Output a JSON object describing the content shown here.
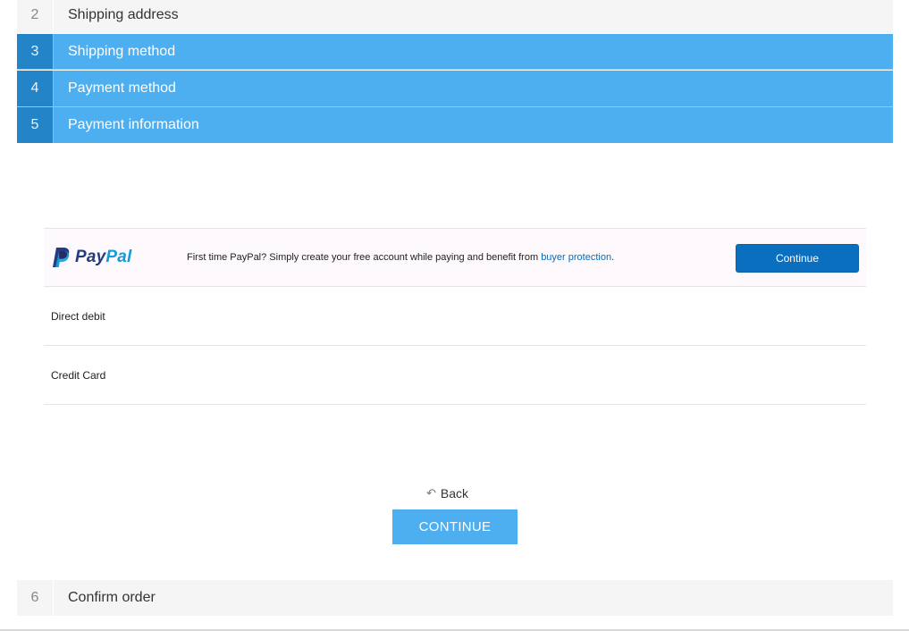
{
  "steps": [
    {
      "number": "2",
      "label": "Shipping address"
    },
    {
      "number": "3",
      "label": "Shipping method"
    },
    {
      "number": "4",
      "label": "Payment method"
    },
    {
      "number": "5",
      "label": "Payment information"
    },
    {
      "number": "6",
      "label": "Confirm order"
    }
  ],
  "payment_info": {
    "paypal": {
      "logo_text_1": "Pay",
      "logo_text_2": "Pal",
      "description": "First time PayPal? Simply create your free account while paying and benefit from ",
      "link_text": "buyer protection",
      "description_end": ".",
      "button_label": "Continue"
    },
    "methods": [
      {
        "label": "Direct debit"
      },
      {
        "label": "Credit Card"
      }
    ]
  },
  "actions": {
    "back_icon": "↶",
    "back_label": "Back",
    "continue_label": "CONTINUE"
  },
  "colors": {
    "active_step": "#4daef0",
    "active_step_number": "#2385c8",
    "paypal_blue_dark": "#253b80",
    "paypal_blue_light": "#179bd7",
    "paypal_button": "#0b6fc0"
  }
}
